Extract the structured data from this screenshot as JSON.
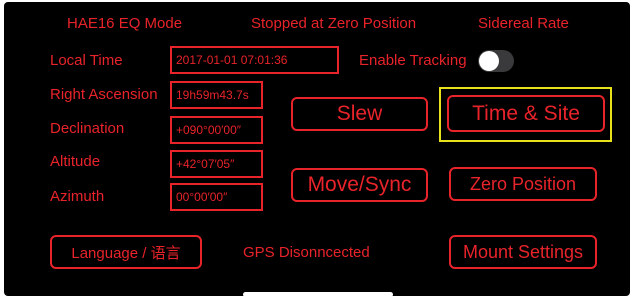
{
  "status": {
    "mode": "HAE16 EQ Mode",
    "position_state": "Stopped at Zero Position",
    "rate": "Sidereal Rate"
  },
  "fields": {
    "local_time": {
      "label": "Local Time",
      "value": "2017-01-01 07:01:36"
    },
    "right_ascension": {
      "label": "Right Ascension",
      "value": "19h59m43.7s"
    },
    "declination": {
      "label": "Declination",
      "value": "+090°00′00″"
    },
    "altitude": {
      "label": "Altitude",
      "value": "+42°07′05″"
    },
    "azimuth": {
      "label": "Azimuth",
      "value": "00°00′00″"
    }
  },
  "tracking": {
    "label": "Enable Tracking",
    "enabled": false
  },
  "buttons": {
    "slew": "Slew",
    "time_site": "Time & Site",
    "move_sync": "Move/Sync",
    "zero_position": "Zero Position",
    "language": "Language / 语言",
    "mount_settings": "Mount Settings"
  },
  "gps_status": "GPS Disonncected",
  "colors": {
    "accent": "#e8232a",
    "highlight": "#e8e21a",
    "background": "#000000"
  }
}
